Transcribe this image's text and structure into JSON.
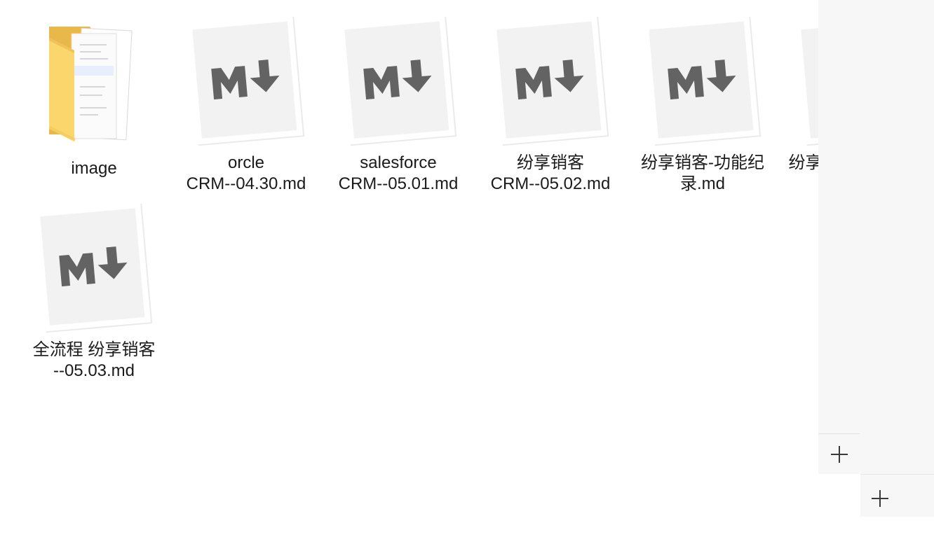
{
  "files": [
    {
      "name": "image",
      "kind": "folder",
      "icon": "folder-icon"
    },
    {
      "name": "orcle\nCRM--04.30.md",
      "kind": "markdown",
      "icon": "markdown-file-icon"
    },
    {
      "name": "salesforce\nCRM--05.01.md",
      "kind": "markdown",
      "icon": "markdown-file-icon"
    },
    {
      "name": "纷享销客\nCRM--05.02.md",
      "kind": "markdown",
      "icon": "markdown-file-icon"
    },
    {
      "name": "纷享销客-功能纪\n录.md",
      "kind": "markdown",
      "icon": "markdown-file-icon"
    },
    {
      "name": "纷享",
      "kind": "markdown",
      "icon": "markdown-file-icon"
    },
    {
      "name": "全流程 纷享销客\n--05.03.md",
      "kind": "markdown",
      "icon": "markdown-file-icon"
    }
  ],
  "side_panel": {
    "add_button_top": "+",
    "add_button_bottom": "+"
  },
  "colors": {
    "folder_back": "#e8b94b",
    "folder_front": "#fcd872",
    "paper": "#f2f2f2",
    "markdown_glyph": "#636363"
  }
}
